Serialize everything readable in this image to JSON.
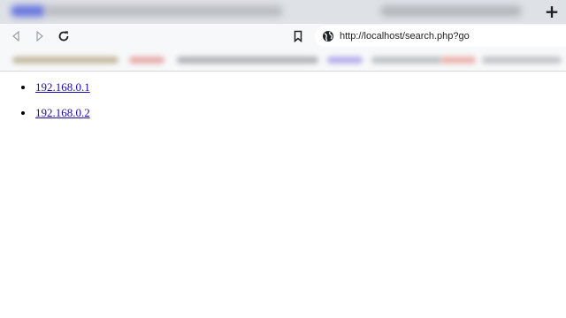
{
  "browser": {
    "new_tab_label": "+",
    "address_bar": {
      "url": "http://localhost/search.php?go"
    },
    "icons": {
      "back": "back-arrow-icon",
      "forward": "forward-arrow-icon",
      "reload": "reload-icon",
      "bookmark": "bookmark-icon",
      "site_info": "globe-icon",
      "new_tab": "plus-icon"
    }
  },
  "page": {
    "results": [
      {
        "text": "192.168.0.1"
      },
      {
        "text": "192.168.0.2"
      }
    ]
  },
  "colors": {
    "link": "#1a0dab",
    "tabstrip": "#dee1e6",
    "toolbar": "#f7f8f9"
  }
}
